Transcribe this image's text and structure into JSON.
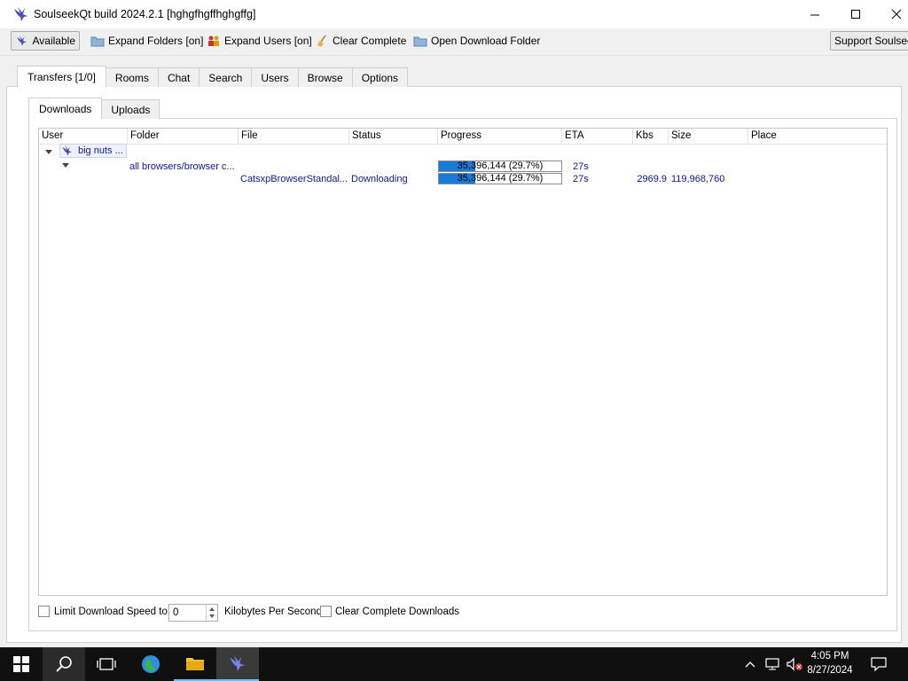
{
  "window": {
    "title": "SoulseekQt build 2024.2.1 [hghgfhgffhghgffg]",
    "icon": "soulseek-bird-icon",
    "controls": [
      "minimize",
      "maximize",
      "close"
    ]
  },
  "toolbar": {
    "available": "Available",
    "expand_folders": "Expand Folders [on]",
    "expand_users": "Expand Users [on]",
    "clear_complete": "Clear Complete",
    "open_download_folder": "Open Download Folder",
    "support": "Support Soulseek"
  },
  "main_tabs": [
    {
      "label": "Transfers [1/0]",
      "active": true
    },
    {
      "label": "Rooms",
      "active": false
    },
    {
      "label": "Chat",
      "active": false
    },
    {
      "label": "Search",
      "active": false
    },
    {
      "label": "Users",
      "active": false
    },
    {
      "label": "Browse",
      "active": false
    },
    {
      "label": "Options",
      "active": false
    }
  ],
  "sub_tabs": [
    {
      "label": "Downloads",
      "active": true
    },
    {
      "label": "Uploads",
      "active": false
    }
  ],
  "table": {
    "columns": [
      "User",
      "Folder",
      "File",
      "Status",
      "Progress",
      "ETA",
      "Kbs",
      "Size",
      "Place"
    ],
    "user_row": {
      "user": "big nuts ..."
    },
    "folder_row": {
      "folder": "all browsers/browser c...",
      "progress": "35,396,144 (29.7%)",
      "progress_fraction": 0.297,
      "eta": "27s"
    },
    "file_row": {
      "file": "CatsxpBrowserStandal...",
      "status": "Downloading",
      "progress": "35,396,144 (29.7%)",
      "progress_fraction": 0.297,
      "eta": "27s",
      "kbs": "2969.9",
      "size": "119,968,760",
      "place": ""
    }
  },
  "bottom": {
    "limit_label": "Limit Download Speed to",
    "limit_checked": false,
    "speed_value": "0",
    "unit_label": "Kilobytes Per Second",
    "clear_label": "Clear Complete Downloads",
    "clear_checked": false
  },
  "taskbar": {
    "time": "4:05 PM",
    "date": "8/27/2024",
    "apps": [
      "start",
      "search",
      "task-view",
      "browser",
      "file-explorer",
      "soulseek"
    ]
  },
  "colors": {
    "accent_blue": "#1a7bd6",
    "link_text": "#0d1a8c",
    "taskbar": "#101010"
  }
}
